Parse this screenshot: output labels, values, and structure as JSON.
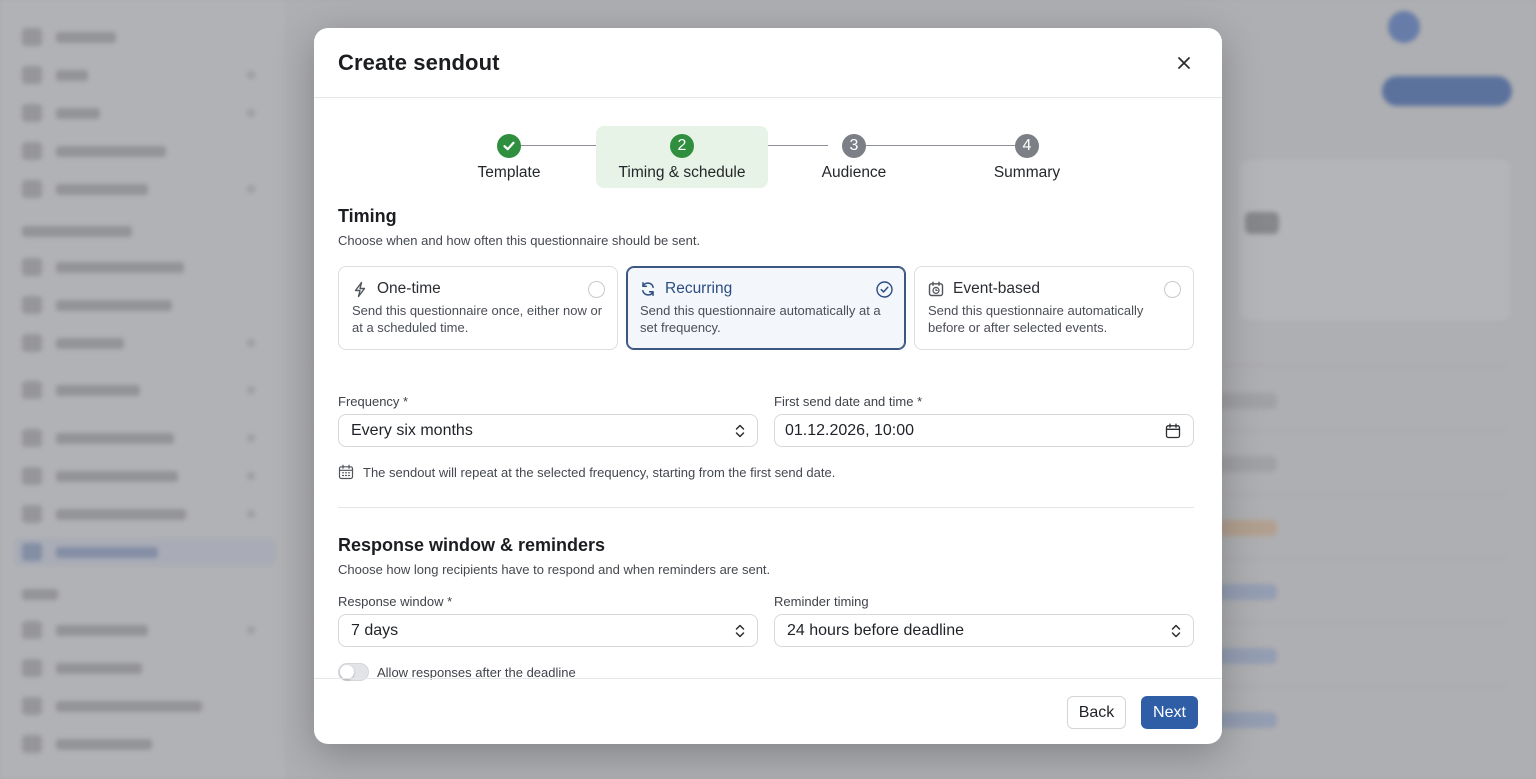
{
  "modal": {
    "title": "Create sendout",
    "steps": [
      {
        "number": "",
        "label": "Template",
        "state": "done"
      },
      {
        "number": "2",
        "label": "Timing & schedule",
        "state": "current"
      },
      {
        "number": "3",
        "label": "Audience",
        "state": "upcoming"
      },
      {
        "number": "4",
        "label": "Summary",
        "state": "upcoming"
      }
    ],
    "timing": {
      "title": "Timing",
      "description": "Choose when and how often this questionnaire should be sent.",
      "options": [
        {
          "title": "One-time",
          "description": "Send this questionnaire once, either now or at a scheduled time.",
          "icon": "lightning-icon",
          "selected": false
        },
        {
          "title": "Recurring",
          "description": "Send this questionnaire automatically at a set frequency.",
          "icon": "refresh-icon",
          "selected": true
        },
        {
          "title": "Event-based",
          "description": "Send this questionnaire automatically before or after selected events.",
          "icon": "calendar-clock-icon",
          "selected": false
        }
      ],
      "frequency_label": "Frequency *",
      "frequency_value": "Every six months",
      "first_send_label": "First send date and time *",
      "first_send_value": "01.12.2026, 10:00",
      "hint": "The sendout will repeat at the selected frequency, starting from the first send date."
    },
    "response": {
      "title": "Response window & reminders",
      "description": "Choose how long recipients have to respond and when reminders are sent.",
      "window_label": "Response window *",
      "window_value": "7 days",
      "reminder_label": "Reminder timing",
      "reminder_value": "24 hours before deadline",
      "allow_late_label": "Allow responses after the deadline",
      "allow_late_enabled": false
    },
    "footer": {
      "back_label": "Back",
      "next_label": "Next"
    }
  },
  "colors": {
    "accent": "#2f5ea6",
    "success": "#2f8f3f",
    "selected_border": "#3b5680",
    "active_step_bg": "#e6f3e6"
  }
}
